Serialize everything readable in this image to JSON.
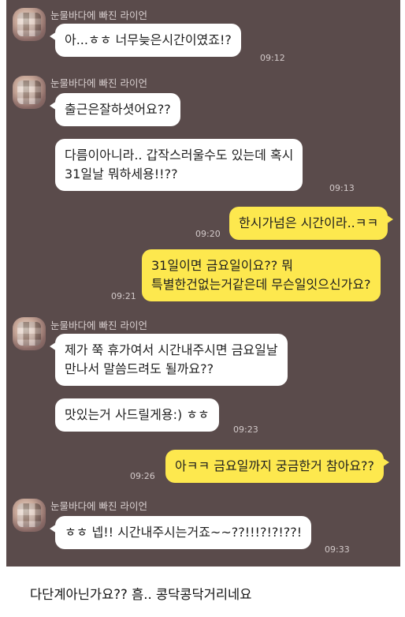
{
  "chat": {
    "sender_name": "눈물바다에 빠진 라이언",
    "messages": [
      {
        "side": "in",
        "text": "아...ㅎㅎ 너무늦은시간이였죠!?",
        "time": "09:12"
      },
      {
        "side": "in",
        "text": "출근은잘하셧어요??",
        "time": ""
      },
      {
        "side": "in",
        "text": "다름이아니라.. 갑작스러울수도 있는데 혹시\n31일날 뭐하세용!!??",
        "time": "09:13"
      },
      {
        "side": "out",
        "text": "한시가넘은 시간이라..ㅋㅋ",
        "time": "09:20"
      },
      {
        "side": "out",
        "text": "31일이면 금요일이요?? 뭐\n특별한건없는거같은데 무슨일잇으신가요?",
        "time": "09:21"
      },
      {
        "side": "in",
        "text": "제가 쭉 휴가여서 시간내주시면 금요일날\n만나서 말씀드려도 될까요??",
        "time": ""
      },
      {
        "side": "in",
        "text": "맛있는거 사드릴게용:) ㅎㅎ",
        "time": "09:23"
      },
      {
        "side": "out",
        "text": "아ㅋㅋ 금요일까지 궁금한거 참아요??",
        "time": "09:26"
      },
      {
        "side": "in",
        "text": "ㅎㅎ 넵!! 시간내주시는거죠~~??!!!?!?!??!",
        "time": "09:33"
      }
    ]
  },
  "caption": "다단계아닌가요?? 흠.. 콩닥콩닥거리네요"
}
